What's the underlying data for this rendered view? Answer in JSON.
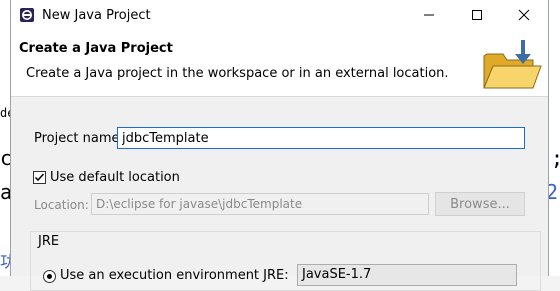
{
  "window": {
    "title": "New Java Project"
  },
  "header": {
    "title": "Create a Java Project",
    "description": "Create a Java project in the workspace or in an external location."
  },
  "form": {
    "project_name_label": "Project name:",
    "project_name_value": "jdbcTemplate",
    "use_default_location_label": "Use default location",
    "use_default_location_checked": true,
    "location_label": "Location:",
    "location_value": "D:\\eclipse for javase\\jdbcTemplate",
    "browse_label": "Browse..."
  },
  "jre": {
    "group_label": "JRE",
    "option_label": "Use an execution environment JRE:",
    "selected_env": "JavaSE-1.7"
  },
  "background": {
    "left_fragments": [
      "de",
      "c",
      "a",
      "功"
    ],
    "right_fragments": [
      ");",
      "2"
    ]
  },
  "colors": {
    "accent": "#1e6bd6",
    "folder": "#f3c54a",
    "arrow": "#3a6ea5"
  }
}
